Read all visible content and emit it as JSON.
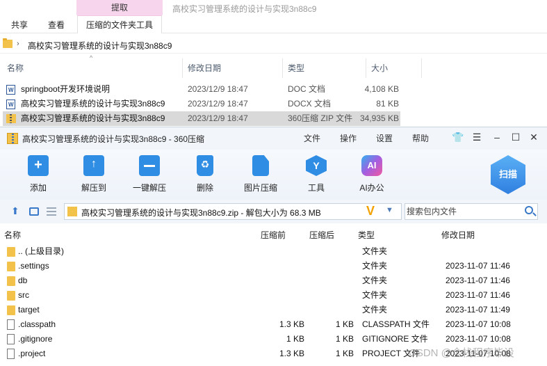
{
  "explorer": {
    "context_tab": "提取",
    "window_title": "高校实习管理系统的设计与实现3n88c9",
    "ribbon_tabs": [
      "共享",
      "查看",
      "压缩的文件夹工具"
    ],
    "breadcrumb": "高校实习管理系统的设计与实现3n88c9",
    "columns": {
      "name": "名称",
      "date": "修改日期",
      "type": "类型",
      "size": "大小"
    },
    "files": [
      {
        "name": "springboot开发环境说明",
        "date": "2023/12/9 18:47",
        "type": "DOC 文档",
        "size": "4,108 KB",
        "icon": "word-doc-icon"
      },
      {
        "name": "高校实习管理系统的设计与实现3n88c9",
        "date": "2023/12/9 18:47",
        "type": "DOCX 文档",
        "size": "81 KB",
        "icon": "word-doc-icon"
      },
      {
        "name": "高校实习管理系统的设计与实现3n88c9",
        "date": "2023/12/9 18:47",
        "type": "360压缩 ZIP 文件",
        "size": "34,935 KB",
        "icon": "zip-archive-icon"
      }
    ]
  },
  "zip": {
    "title": "高校实习管理系统的设计与实现3n88c9 - 360压缩",
    "menu": [
      "文件",
      "操作",
      "设置",
      "帮助"
    ],
    "toolbar": [
      "添加",
      "解压到",
      "一键解压",
      "删除",
      "图片压缩",
      "工具",
      "AI办公"
    ],
    "scan_label": "扫描",
    "path_text": "高校实习管理系统的设计与实现3n88c9.zip - 解包大小为 68.3 MB",
    "search_placeholder": "搜索包内文件",
    "columns": {
      "name": "名称",
      "compressed": "压缩前",
      "uncompressed": "压缩后",
      "type": "类型",
      "date": "修改日期"
    },
    "rows": [
      {
        "name": ".. (上级目录)",
        "before": "",
        "after": "",
        "type": "文件夹",
        "date": "",
        "kind": "folder"
      },
      {
        "name": ".settings",
        "before": "",
        "after": "",
        "type": "文件夹",
        "date": "2023-11-07 11:46",
        "kind": "folder"
      },
      {
        "name": "db",
        "before": "",
        "after": "",
        "type": "文件夹",
        "date": "2023-11-07 11:46",
        "kind": "folder"
      },
      {
        "name": "src",
        "before": "",
        "after": "",
        "type": "文件夹",
        "date": "2023-11-07 11:46",
        "kind": "folder"
      },
      {
        "name": "target",
        "before": "",
        "after": "",
        "type": "文件夹",
        "date": "2023-11-07 11:49",
        "kind": "folder"
      },
      {
        "name": ".classpath",
        "before": "1.3 KB",
        "after": "1 KB",
        "type": "CLASSPATH 文件",
        "date": "2023-11-07 10:08",
        "kind": "file"
      },
      {
        "name": ".gitignore",
        "before": "1 KB",
        "after": "1 KB",
        "type": "GITIGNORE 文件",
        "date": "2023-11-07 10:08",
        "kind": "file"
      },
      {
        "name": ".project",
        "before": "1.3 KB",
        "after": "1 KB",
        "type": "PROJECT 文件",
        "date": "2023-11-07 10:08",
        "kind": "file"
      }
    ]
  },
  "watermark": "CSDN @全栈程序毕设"
}
